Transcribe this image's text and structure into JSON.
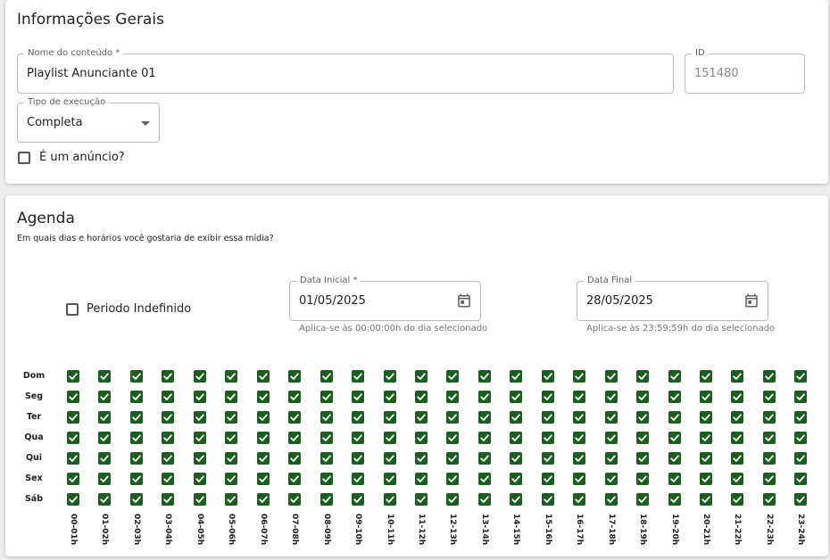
{
  "general": {
    "title": "Informações Gerais",
    "content_name": {
      "label": "Nome do conteúdo *",
      "value": "Playlist Anunciante 01"
    },
    "id_field": {
      "label": "ID",
      "value": "151480"
    },
    "execution_type": {
      "label": "Tipo de execução",
      "value": "Completa"
    },
    "is_ad": {
      "label": "É um anúncio?",
      "checked": false
    }
  },
  "agenda": {
    "title": "Agenda",
    "subtitle": "Em quais dias e horários você gostaria de exibir essa mídia?",
    "indefinite": {
      "label": "Periodo Indefinido",
      "checked": false
    },
    "start_date": {
      "label": "Data Inicial *",
      "value": "01/05/2025",
      "helper": "Aplica-se às 00:00:00h do dia selecionado"
    },
    "end_date": {
      "label": "Data Final",
      "value": "28/05/2025",
      "helper": "Aplica-se às 23:59:59h do dia selecionado"
    },
    "days": [
      "Dom",
      "Seg",
      "Ter",
      "Qua",
      "Qui",
      "Sex",
      "Sáb"
    ],
    "hours": [
      "00-01h",
      "01-02h",
      "02-03h",
      "03-04h",
      "04-05h",
      "05-06h",
      "06-07h",
      "07-08h",
      "08-09h",
      "09-10h",
      "10-11h",
      "11-12h",
      "12-13h",
      "13-14h",
      "14-15h",
      "15-16h",
      "16-17h",
      "17-18h",
      "18-19h",
      "19-20h",
      "20-21h",
      "21-22h",
      "22-23h",
      "23-24h"
    ],
    "all_checked": true,
    "check_color": "#1b5e20"
  }
}
